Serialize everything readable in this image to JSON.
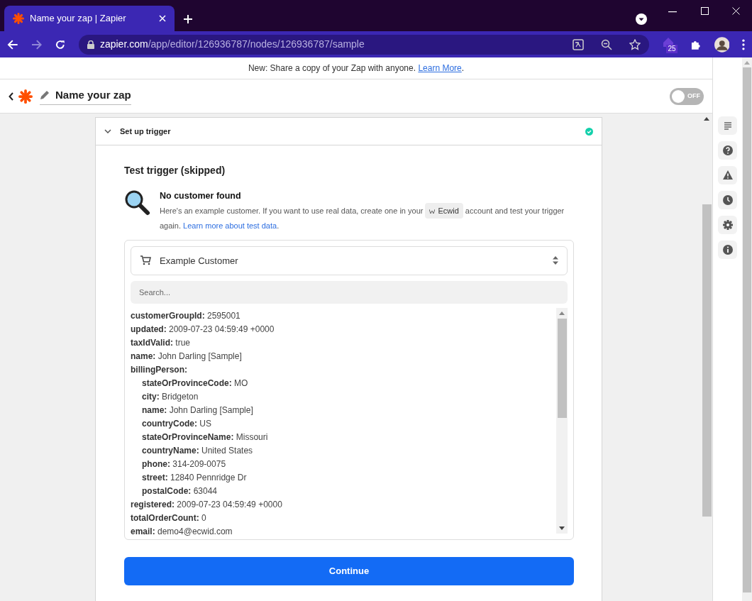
{
  "browser": {
    "tab_title": "Name your zap | Zapier",
    "url_host": "zapier.com",
    "url_path": "/app/editor/126936787/nodes/126936787/sample",
    "extension_badge": "25"
  },
  "banner": {
    "text": "New: Share a copy of your Zap with anyone.",
    "link": "Learn More",
    "after": "."
  },
  "header": {
    "title": "Name your zap",
    "toggle": {
      "label": "OFF",
      "on": false
    }
  },
  "step": {
    "title": "Set up trigger",
    "expanded": true,
    "complete": true
  },
  "test": {
    "heading": "Test trigger (skipped)",
    "notice_title": "No customer found",
    "notice_text": "Here's an example customer. If you want to use real data, create one in your",
    "app": "Ecwid",
    "notice_text_after": "account and test your trigger again.",
    "link": "Learn more about test data",
    "link_after": "."
  },
  "select": {
    "value": "Example Customer"
  },
  "search": {
    "placeholder": "Search..."
  },
  "records": [
    {
      "key": "customerGroupId:",
      "value": "2595001"
    },
    {
      "key": "updated:",
      "value": "2009-07-23 04:59:49 +0000"
    },
    {
      "key": "taxIdValid:",
      "value": "true"
    },
    {
      "key": "name:",
      "value": "John Darling [Sample]"
    },
    {
      "key": "billingPerson:",
      "children": [
        {
          "key": "stateOrProvinceCode:",
          "value": "MO"
        },
        {
          "key": "city:",
          "value": "Bridgeton"
        },
        {
          "key": "name:",
          "value": "John Darling [Sample]"
        },
        {
          "key": "countryCode:",
          "value": "US"
        },
        {
          "key": "stateOrProvinceName:",
          "value": "Missouri"
        },
        {
          "key": "countryName:",
          "value": "United States"
        },
        {
          "key": "phone:",
          "value": "314-209-0075"
        },
        {
          "key": "street:",
          "value": "12840 Pennridge Dr"
        },
        {
          "key": "postalCode:",
          "value": "63044"
        }
      ]
    },
    {
      "key": "registered:",
      "value": "2009-07-23 04:59:49 +0000"
    },
    {
      "key": "totalOrderCount:",
      "value": "0"
    },
    {
      "key": "email:",
      "value": "demo4@ecwid.com"
    }
  ],
  "button": "Continue",
  "side_tools": [
    {
      "kind": "details"
    },
    {
      "kind": "help"
    },
    {
      "kind": "alert"
    },
    {
      "kind": "history"
    },
    {
      "kind": "settings"
    },
    {
      "kind": "info"
    }
  ]
}
